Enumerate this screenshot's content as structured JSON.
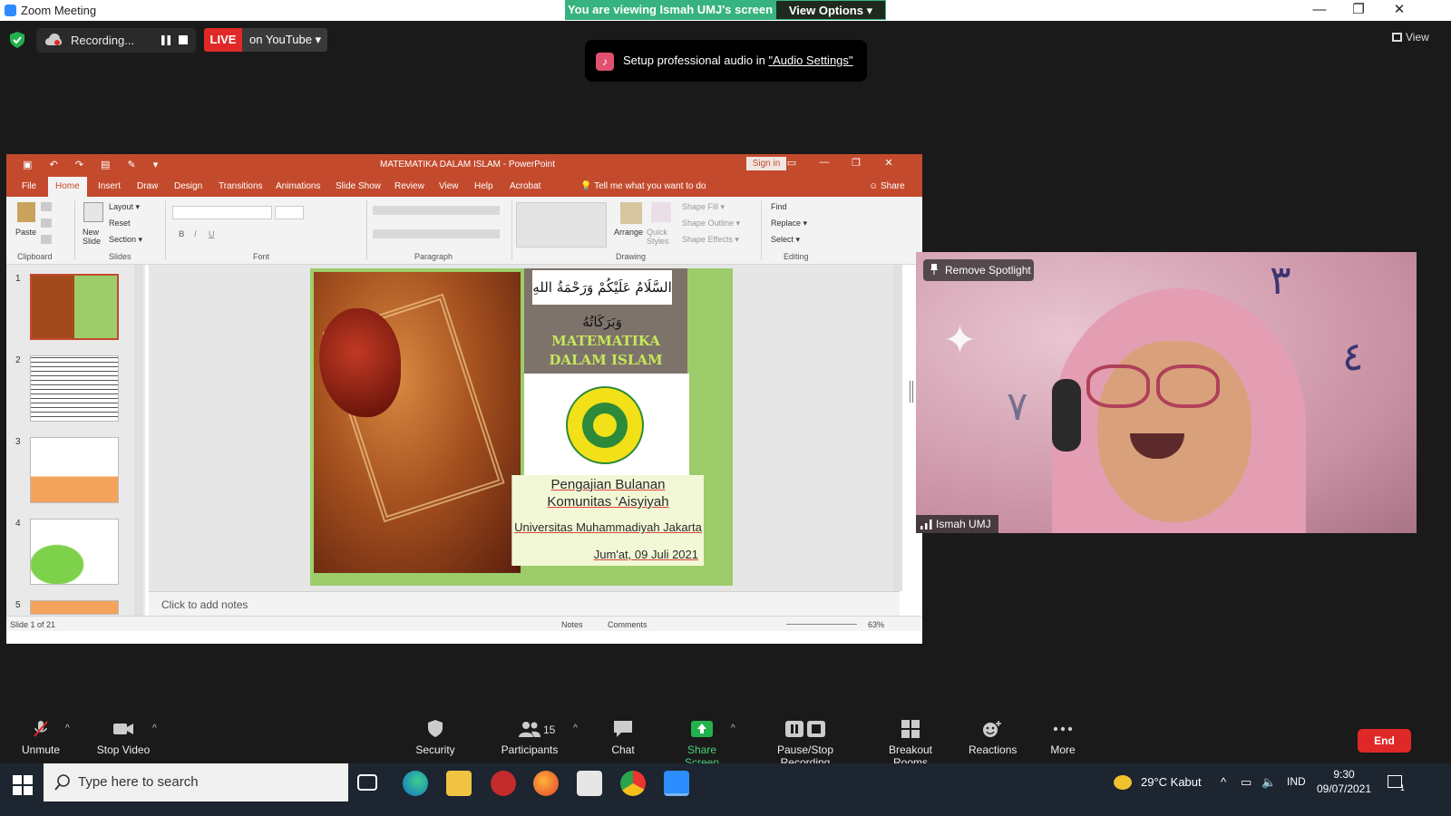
{
  "window": {
    "title": "Zoom Meeting",
    "minimize": "—",
    "restore": "❐",
    "close": "✕"
  },
  "banner": {
    "viewing": "You are viewing Ismah UMJ's screen",
    "view_options": "View Options ▾"
  },
  "top_bar": {
    "recording_label": "Recording...",
    "live_label": "LIVE",
    "live_target": "on YouTube ▾",
    "view_label": "View"
  },
  "toast": {
    "prefix": "Setup professional audio in ",
    "link": "\"Audio Settings\""
  },
  "powerpoint": {
    "doc_title": "MATEMATIKA DALAM ISLAM  -  PowerPoint",
    "sign_in": "Sign in",
    "tabs": [
      "File",
      "Home",
      "Insert",
      "Draw",
      "Design",
      "Transitions",
      "Animations",
      "Slide Show",
      "Review",
      "View",
      "Help",
      "Acrobat"
    ],
    "tell_me": "Tell me what you want to do",
    "share": "Share",
    "ribbon": {
      "paste": "Paste",
      "new_slide": "New Slide",
      "layout": "Layout ▾",
      "reset": "Reset",
      "section": "Section ▾",
      "arrange": "Arrange",
      "quick_styles": "Quick Styles",
      "shape_fill": "Shape Fill ▾",
      "shape_outline": "Shape Outline ▾",
      "shape_effects": "Shape Effects ▾",
      "find": "Find",
      "replace": "Replace ▾",
      "select": "Select ▾",
      "groups": [
        "Clipboard",
        "Slides",
        "Font",
        "Paragraph",
        "Drawing",
        "Editing"
      ]
    },
    "thumb_numbers": [
      "1",
      "2",
      "3",
      "4",
      "5"
    ],
    "notes_placeholder": "Click to add notes",
    "status": {
      "slide_count": "Slide 1 of 21",
      "notes": "Notes",
      "comments": "Comments",
      "zoom": "63%"
    },
    "slide": {
      "arabic": "السَّلَامُ عَلَيْكُمْ وَرَحْمَةُ اللهِ وَبَرَكَاتُهُ",
      "title_line1": "MATEMATIKA",
      "title_line2": "DALAM ISLAM",
      "caption1": "Pengajian Bulanan",
      "caption2": "Komunitas ‘Aisyiyah",
      "caption3": "Universitas Muhammadiyah Jakarta",
      "caption4": "Jum'at, 09 Juli 2021"
    }
  },
  "video": {
    "remove_spotlight": "Remove Spotlight",
    "participant_name": "Ismah UMJ"
  },
  "toolbar": {
    "unmute": "Unmute",
    "stop_video": "Stop Video",
    "security": "Security",
    "participants": "Participants",
    "participants_count": "15",
    "chat": "Chat",
    "share_screen": "Share Screen",
    "pause_stop_recording": "Pause/Stop Recording",
    "breakout_rooms": "Breakout Rooms",
    "reactions": "Reactions",
    "more": "More",
    "end": "End"
  },
  "taskbar": {
    "search_placeholder": "Type here to search",
    "weather": "29°C  Kabut",
    "language": "IND",
    "time": "9:30",
    "date": "09/07/2021",
    "notification_count": "1"
  },
  "colors": {
    "accent_green": "#36b37e",
    "ppt_red": "#c44a2d",
    "live_red": "#e02828"
  }
}
